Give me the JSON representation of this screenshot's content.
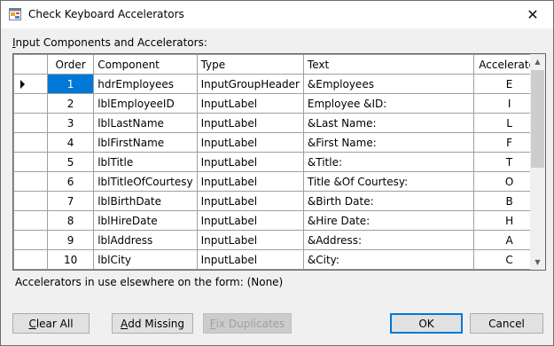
{
  "window": {
    "title": "Check Keyboard Accelerators",
    "close_glyph": "✕"
  },
  "group_label": "Input Components and Accelerators:",
  "grid": {
    "columns": [
      "Order",
      "Component",
      "Type",
      "Text",
      "Accelerator"
    ],
    "current_row": 0,
    "rows": [
      {
        "order": "1",
        "component": "hdrEmployees",
        "type": "InputGroupHeader",
        "text": "&Employees",
        "accelerator": "E"
      },
      {
        "order": "2",
        "component": "lblEmployeeID",
        "type": "InputLabel",
        "text": "Employee &ID:",
        "accelerator": "I"
      },
      {
        "order": "3",
        "component": "lblLastName",
        "type": "InputLabel",
        "text": "&Last Name:",
        "accelerator": "L"
      },
      {
        "order": "4",
        "component": "lblFirstName",
        "type": "InputLabel",
        "text": "&First Name:",
        "accelerator": "F"
      },
      {
        "order": "5",
        "component": "lblTitle",
        "type": "InputLabel",
        "text": "&Title:",
        "accelerator": "T"
      },
      {
        "order": "6",
        "component": "lblTitleOfCourtesy",
        "type": "InputLabel",
        "text": "Title &Of Courtesy:",
        "accelerator": "O"
      },
      {
        "order": "7",
        "component": "lblBirthDate",
        "type": "InputLabel",
        "text": "&Birth Date:",
        "accelerator": "B"
      },
      {
        "order": "8",
        "component": "lblHireDate",
        "type": "InputLabel",
        "text": "&Hire Date:",
        "accelerator": "H"
      },
      {
        "order": "9",
        "component": "lblAddress",
        "type": "InputLabel",
        "text": "&Address:",
        "accelerator": "A"
      },
      {
        "order": "10",
        "component": "lblCity",
        "type": "InputLabel",
        "text": "&City:",
        "accelerator": "C"
      }
    ]
  },
  "elsewhere_text": "Accelerators in use elsewhere on the form: (None)",
  "buttons": {
    "clear_all": "Clear All",
    "add_missing": "Add Missing",
    "fix_duplicates": "Fix Duplicates",
    "ok": "OK",
    "cancel": "Cancel"
  },
  "icons": {
    "app": "form-app-icon",
    "close": "close-icon",
    "row_indicator": "current-row-arrow-icon",
    "scroll_up": "scroll-up-icon",
    "scroll_down": "scroll-down-icon"
  },
  "colors": {
    "selection": "#0078d7",
    "dialog_bg": "#f0f0f0",
    "grid_bg": "#ababab"
  }
}
